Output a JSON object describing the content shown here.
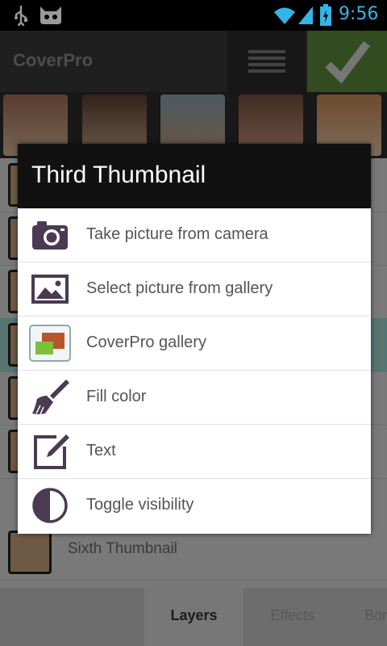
{
  "status_bar": {
    "time": "9:56",
    "icons": [
      "usb-icon",
      "android-icon",
      "wifi-icon",
      "signal-icon",
      "battery-icon"
    ],
    "accent": "#33b5e5"
  },
  "action_bar": {
    "title": "CoverPro",
    "icons": [
      "menu-icon",
      "check-icon"
    ],
    "check_bg": "#5b8a3a"
  },
  "background_list": {
    "rows": [
      {
        "label": ""
      },
      {
        "label": ""
      },
      {
        "label": ""
      },
      {
        "label": ""
      },
      {
        "label": ""
      },
      {
        "label": ""
      },
      {
        "label": "Sixth Thumbnail"
      }
    ]
  },
  "tabs": [
    {
      "label": "Layers",
      "active": true
    },
    {
      "label": "Effects",
      "active": false
    },
    {
      "label": "Bor",
      "active": false
    }
  ],
  "dialog": {
    "title": "Third Thumbnail",
    "items": [
      {
        "label": "Take picture from camera",
        "icon": "camera-icon"
      },
      {
        "label": "Select picture from gallery",
        "icon": "picture-icon"
      },
      {
        "label": "CoverPro gallery",
        "icon": "coverpro-gallery-icon"
      },
      {
        "label": "Fill color",
        "icon": "brush-icon"
      },
      {
        "label": "Text",
        "icon": "edit-icon"
      },
      {
        "label": "Toggle visibility",
        "icon": "contrast-icon"
      }
    ],
    "icon_color": "#4a3a52"
  }
}
